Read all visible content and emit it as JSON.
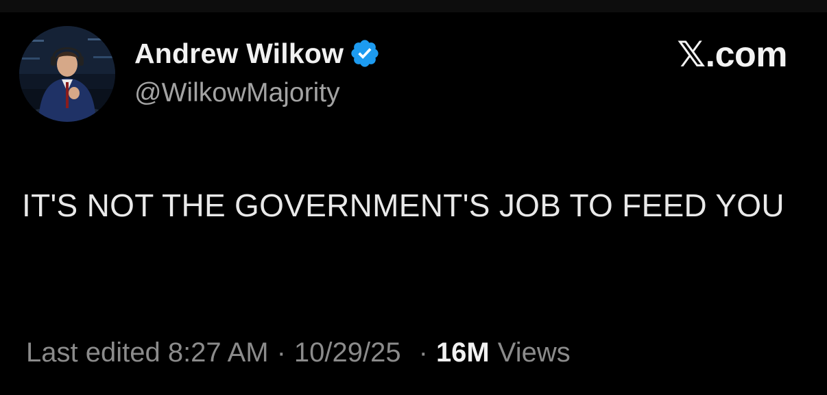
{
  "tweet": {
    "author": {
      "display_name": "Andrew Wilkow",
      "handle": "@WilkowMajority",
      "verified": true,
      "badge_color": "#1d9bf0"
    },
    "site_mark": "𝕏.com",
    "text": "IT'S NOT THE GOVERNMENT'S JOB TO FEED YOU",
    "meta": {
      "edited_label": "Last edited 8:27 AM",
      "separator": "·",
      "date": "10/29/25",
      "views_count": "16M",
      "views_label": "Views"
    }
  },
  "colors": {
    "background": "#000000",
    "primary_text": "#e9e9e9",
    "secondary_text": "#a3a3a3",
    "meta_text": "#8b8b8b"
  },
  "icons": {
    "verified": "verified-badge-icon"
  }
}
